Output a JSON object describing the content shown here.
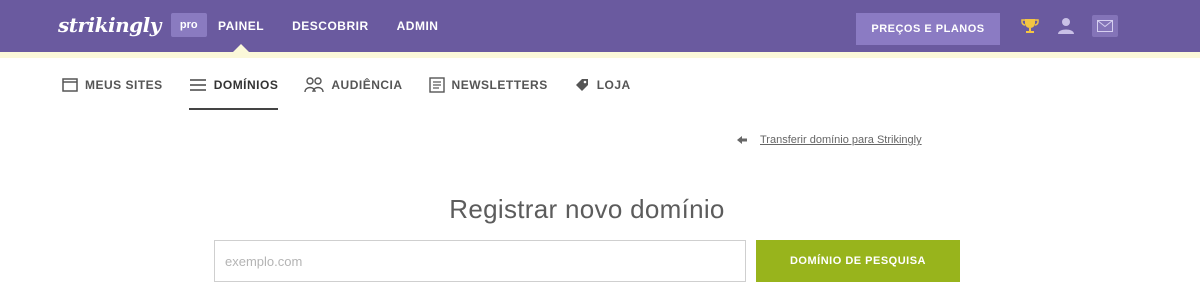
{
  "header": {
    "logo": "strikingly",
    "plan_badge": "pro",
    "nav": [
      {
        "label": "PAINEL",
        "active": true
      },
      {
        "label": "DESCOBRIR",
        "active": false
      },
      {
        "label": "ADMIN",
        "active": false
      }
    ],
    "pricing_button": "PREÇOS E PLANOS",
    "icons": [
      "trophy-icon",
      "user-icon",
      "mail-icon"
    ]
  },
  "subnav": [
    {
      "label": "MEUS SITES",
      "icon": "window-icon",
      "active": false
    },
    {
      "label": "DOMÍNIOS",
      "icon": "list-icon",
      "active": true
    },
    {
      "label": "AUDIÊNCIA",
      "icon": "people-icon",
      "active": false
    },
    {
      "label": "NEWSLETTERS",
      "icon": "newsletter-icon",
      "active": false
    },
    {
      "label": "LOJA",
      "icon": "tag-icon",
      "active": false
    }
  ],
  "main": {
    "transfer_link": "Transferir domínio para Strikingly",
    "title": "Registrar novo domínio",
    "search": {
      "value": "",
      "placeholder": "exemplo.com",
      "button": "DOMÍNIO DE PESQUISA"
    }
  },
  "colors": {
    "topbar": "#6a5a9f",
    "accent_button": "#98b41c",
    "pricing_button": "#8b7bc3"
  }
}
